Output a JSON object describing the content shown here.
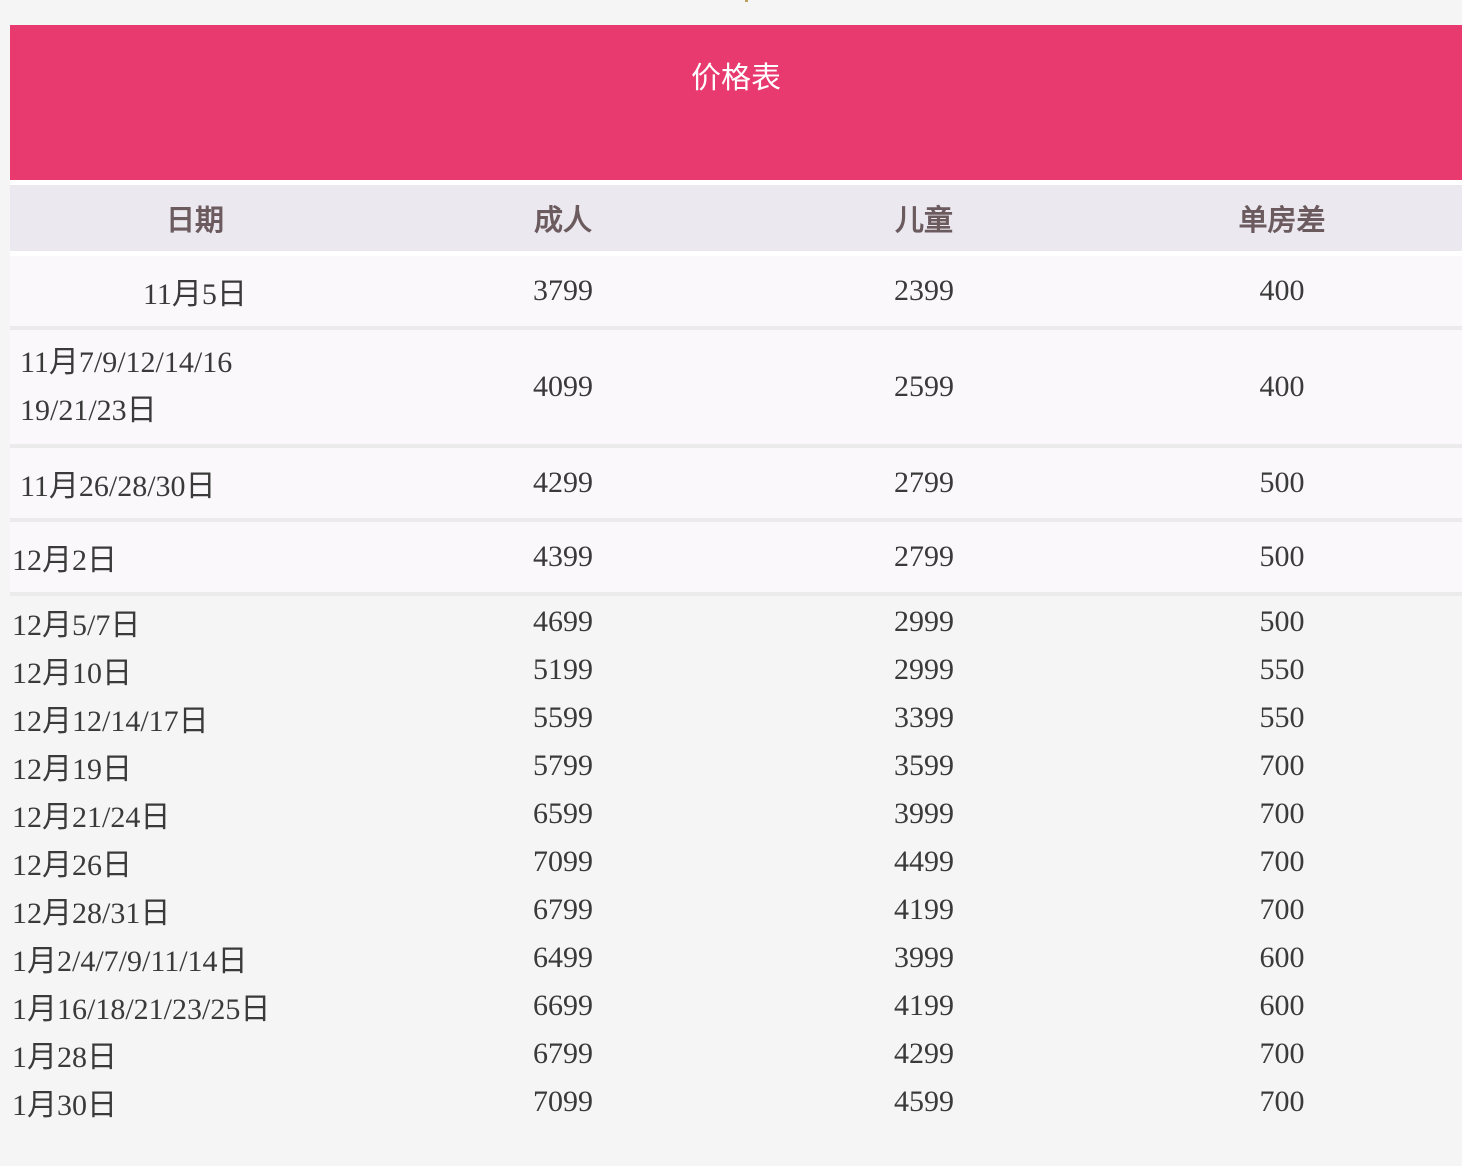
{
  "table": {
    "title": "价格表",
    "headers": [
      "日期",
      "成人",
      "儿童",
      "单房差"
    ],
    "boxed_rows": [
      {
        "date": "11月5日",
        "adult": "3799",
        "child": "2399",
        "single": "400"
      },
      {
        "date_lines": [
          "11月7/9/12/14/16",
          "19/21/23日"
        ],
        "adult": "4099",
        "child": "2599",
        "single": "400"
      },
      {
        "date": "11月26/28/30日",
        "adult": "4299",
        "child": "2799",
        "single": "500"
      },
      {
        "date": "12月2日",
        "adult": "4399",
        "child": "2799",
        "single": "500"
      }
    ],
    "plain_rows": [
      {
        "date": "12月5/7日",
        "adult": "4699",
        "child": "2999",
        "single": "500"
      },
      {
        "date": "12月10日",
        "adult": "5199",
        "child": "2999",
        "single": "550"
      },
      {
        "date": "12月12/14/17日",
        "adult": "5599",
        "child": "3399",
        "single": "550"
      },
      {
        "date": "12月19日",
        "adult": "5799",
        "child": "3599",
        "single": "700"
      },
      {
        "date": "12月21/24日",
        "adult": "6599",
        "child": "3999",
        "single": "700"
      },
      {
        "date": "12月26日",
        "adult": "7099",
        "child": "4499",
        "single": "700"
      },
      {
        "date": "12月28/31日",
        "adult": "6799",
        "child": "4199",
        "single": "700"
      },
      {
        "date": "1月2/4/7/9/11/14日",
        "adult": "6499",
        "child": "3999",
        "single": "600"
      },
      {
        "date": "1月16/18/21/23/25日",
        "adult": "6699",
        "child": "4199",
        "single": "600"
      },
      {
        "date": "1月28日",
        "adult": "6799",
        "child": "4299",
        "single": "700"
      },
      {
        "date": "1月30日",
        "adult": "7099",
        "child": "4599",
        "single": "700"
      }
    ]
  },
  "colors": {
    "banner": "#e83a6f",
    "header_bg": "#ece8ef",
    "header_text": "#6b5b5f",
    "row_bg": "#faf8fa",
    "page_bg": "#f5f5f5"
  }
}
